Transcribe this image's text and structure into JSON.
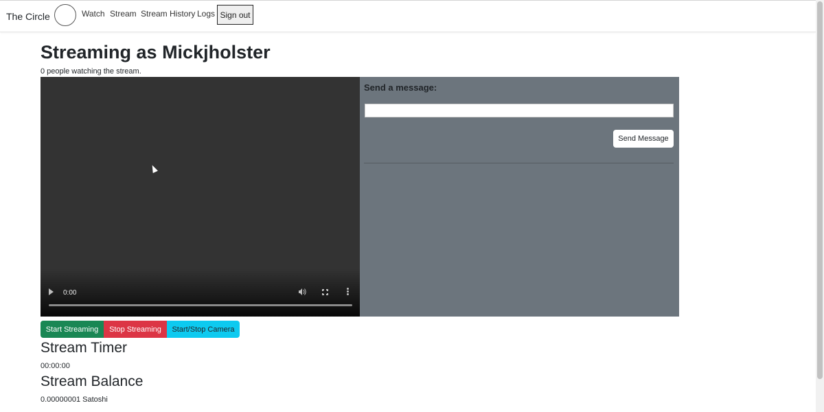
{
  "navbar": {
    "brand": "The Circle",
    "links": [
      "Watch",
      "Stream",
      "Stream History",
      "Logs"
    ],
    "signout_label": "Sign out"
  },
  "page": {
    "title": "Streaming as Mickjholster",
    "viewers_text": "0 people watching the stream."
  },
  "video": {
    "time": "0:00",
    "progress": 0
  },
  "chat": {
    "label": "Send a message:",
    "input_value": "",
    "send_label": "Send Message"
  },
  "controls": {
    "start_label": "Start Streaming",
    "stop_label": "Stop Streaming",
    "camera_label": "Start/Stop Camera"
  },
  "timer": {
    "heading": "Stream Timer",
    "value": "00:00:00"
  },
  "balance": {
    "heading": "Stream Balance",
    "value": "0.00000001 Satoshi"
  },
  "colors": {
    "start": "#198754",
    "stop": "#dc3545",
    "camera": "#0dcaf0",
    "chat_bg": "#6c757d",
    "video_bg": "#333333"
  },
  "icons": [
    "play-icon",
    "volume-icon",
    "fullscreen-icon",
    "more-options-icon"
  ]
}
